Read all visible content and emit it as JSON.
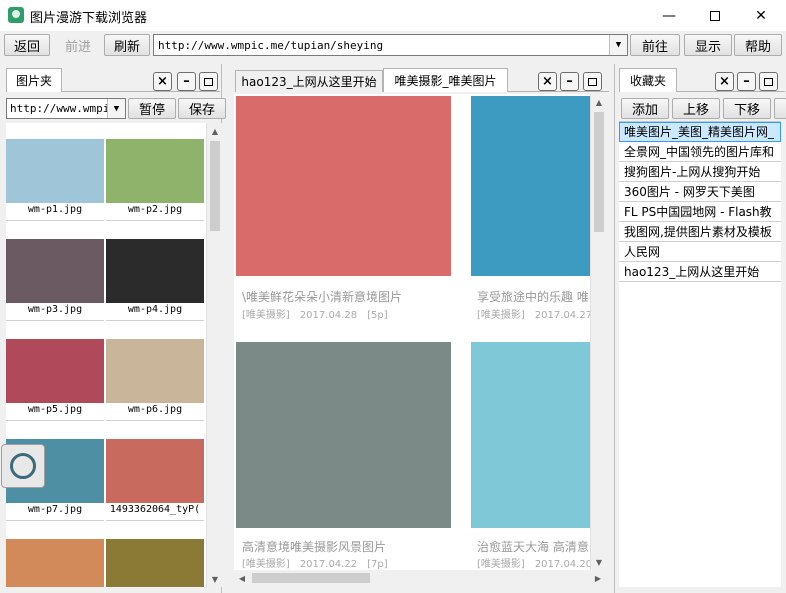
{
  "window": {
    "title": "图片漫游下载浏览器",
    "min_icon": "minimize-icon",
    "max_icon": "maximize-icon",
    "close_icon": "close-icon"
  },
  "toolbar": {
    "back": "返回",
    "forward": "前进",
    "refresh": "刷新",
    "url": "http://www.wmpic.me/tupian/sheying",
    "go": "前往",
    "show": "显示",
    "help": "帮助"
  },
  "left_panel": {
    "tab": "图片夹",
    "folder_value": "http://www.wmpic",
    "pause": "暂停",
    "save": "保存",
    "thumbnails": [
      {
        "caption": "wm-p1.jpg",
        "color": "#9fc5d8"
      },
      {
        "caption": "wm-p2.jpg",
        "color": "#8fb36a"
      },
      {
        "caption": "wm-p3.jpg",
        "color": "#6c5a63"
      },
      {
        "caption": "wm-p4.jpg",
        "color": "#2b2b2b"
      },
      {
        "caption": "wm-p5.jpg",
        "color": "#b04a5a"
      },
      {
        "caption": "wm-p6.jpg",
        "color": "#c9b59a"
      },
      {
        "caption": "wm-p7.jpg",
        "color": "#4f8fa3"
      },
      {
        "caption": "1493362064_tyP(",
        "color": "#c96a5f"
      },
      {
        "caption": "",
        "color": "#d38a5a"
      },
      {
        "caption": "",
        "color": "#8a7a35"
      }
    ]
  },
  "mid_panel": {
    "tabs": [
      "hao123_上网从这里开始",
      "唯美摄影_唯美图片"
    ],
    "cards": [
      {
        "title": "\\唯美鲜花朵朵小清新意境图片",
        "cat": "[唯美摄影]",
        "date": "2017.04.28",
        "count": "[5p]",
        "color": "#d96b6b"
      },
      {
        "title": "享受旅途中的乐趣 唯",
        "cat": "[唯美摄影]",
        "date": "2017.04.27",
        "count": "",
        "color": "#3d9ac0"
      },
      {
        "title": "高清意境唯美摄影风景图片",
        "cat": "[唯美摄影]",
        "date": "2017.04.22",
        "count": "[7p]",
        "color": "#7b8a86"
      },
      {
        "title": "治愈蓝天大海 高清意",
        "cat": "[唯美摄影]",
        "date": "2017.04.20",
        "count": "",
        "color": "#7fc8d8"
      }
    ]
  },
  "right_panel": {
    "tab": "收藏夹",
    "add": "添加",
    "up": "上移",
    "down": "下移",
    "favorites": [
      "唯美图片_美图_精美图片网_",
      "全景网_中国领先的图片库和",
      "搜狗图片-上网从搜狗开始",
      "360图片 - 网罗天下美图",
      "FL PS中国园地网 - Flash教",
      "我图网,提供图片素材及模板",
      "人民网",
      "hao123_上网从这里开始"
    ]
  }
}
